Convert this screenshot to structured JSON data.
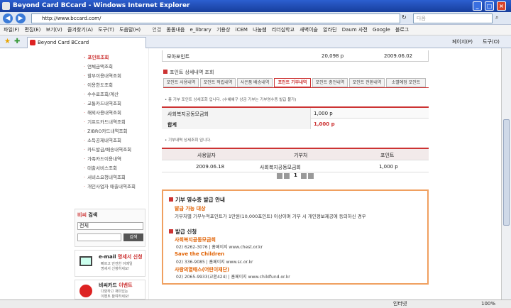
{
  "window": {
    "title": "Beyond Card BCcard - Windows Internet Explorer"
  },
  "address": {
    "url": "http://www.bccard.com/",
    "search_placeholder": "다음"
  },
  "menu": [
    "파일(F)",
    "편집(E)",
    "보기(V)",
    "즐겨찾기(A)",
    "도구(T)",
    "도움말(H)"
  ],
  "links": {
    "label": "연결",
    "items": [
      "몸몸내음",
      "e_library",
      "기용상",
      "iCEM",
      "나눔쌤",
      "리더십학교",
      "새벽이슬",
      "알라딘",
      "Daum 사전",
      "Google",
      "블로그"
    ]
  },
  "tab": {
    "title": "Beyond Card BCcard",
    "tools": [
      "페이지(P)",
      "도구(O)"
    ]
  },
  "sidebar": {
    "items": [
      "포인트조회",
      "연체금액조회",
      "할부이용내역조회",
      "이용한도조회",
      "수수료조회/계산",
      "교통카드내역조회",
      "해외사용내역조회",
      "기프트카드내역조회",
      "ZIBRO카드내역조회",
      "소득공제내역조회",
      "카드발급/배송내역조회",
      "가족카드이용내역",
      "대출서비스조회",
      "서비스요청내역조회",
      "개인사업자 매출내역조회"
    ],
    "search": {
      "title_a": "비씨",
      "title_b": "검색",
      "select": "전체",
      "button": "검색"
    },
    "email": {
      "title_a": "e-mail",
      "title_b": "명세서 신청",
      "desc": [
        "빠르고 안전한 이메일",
        "명세서 신청하세요!"
      ]
    },
    "bccard_event": {
      "title_a": "비씨카드",
      "title_b": "이벤트",
      "desc": [
        "다양하고 재미있는",
        "이벤트 참여하세요!"
      ]
    }
  },
  "top_row": {
    "name": "모아포인트",
    "points": "20,098 p",
    "date": "2009.06.02"
  },
  "detail": {
    "title": "포인트 상세내역 조회",
    "tabs": [
      "포인트 사용내역",
      "포인트 적립내역",
      "사은품 배송내역",
      "포인트 기부내역",
      "포인트 충전내역",
      "포인트 전환내역",
      "소멸예정 포인트"
    ],
    "note": "총 기부 포인트 상세조회 입니다. (수혜혜구 상금 기부는 기부영수증 발급 불가)",
    "summary": [
      {
        "label": "사회복지공동모금회",
        "value": "1,000 p"
      },
      {
        "label": "합계",
        "value": "1,000 p"
      }
    ],
    "note2": "기부내역 상세조회 입니다.",
    "headers": [
      "사용일자",
      "기부처",
      "포인트"
    ],
    "rows": [
      {
        "date": "2009.06.18",
        "org": "사회복지공동모금회",
        "points": "1,000 p"
      }
    ],
    "page": "1"
  },
  "receipt": {
    "title": "기부 영수증 발급 안내",
    "sub1": "발급 가능 대상",
    "sub1_text": "기부처별 기부누적포인트가 1만원(10,000포인트) 이상이며 기부 시 개인정보제공에 동의하신 경우",
    "sub2": "발급 신청",
    "orgs": [
      {
        "name": "사회복지공동모금회",
        "contact": "02) 6262-3076 | 홈페이지 www.chest.or.kr"
      },
      {
        "name": "Save the Children",
        "contact": "02) 336-9085 | 홈페이지 www.sc.or.kr"
      },
      {
        "name": "사랑의열매스(어린이재단)",
        "contact": "02) 2065-9933(교환424) | 홈페이지 www.childfund.or.kr"
      }
    ]
  },
  "status": {
    "zone": "인터넷",
    "zoom": "100%"
  }
}
